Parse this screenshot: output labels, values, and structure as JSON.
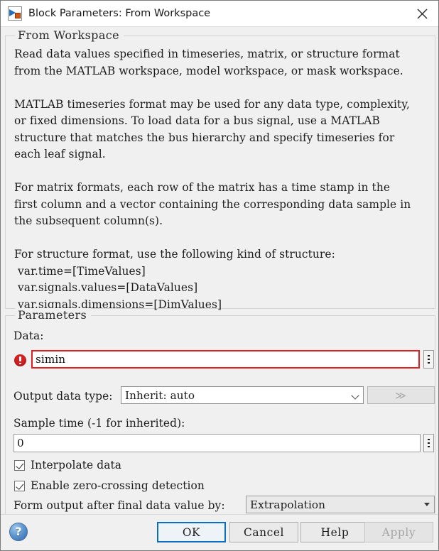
{
  "window": {
    "title": "Block Parameters: From Workspace",
    "icon": "simulink-block-icon",
    "close_label": "close-icon"
  },
  "description_group": {
    "legend": "From Workspace",
    "text": "Read data values specified in timeseries, matrix, or structure format\nfrom the MATLAB workspace, model workspace, or mask workspace.\n\nMATLAB timeseries format may be used for any data type, complexity,\nor fixed dimensions. To load data for a bus signal, use a MATLAB\nstructure that matches the bus hierarchy and specify timeseries for\neach leaf signal.\n\nFor matrix formats, each row of the matrix has a time stamp in the\nfirst column and a vector containing the corresponding data sample in\nthe subsequent column(s).\n\nFor structure format, use the following kind of structure:\n var.time=[TimeValues]\n var.signals.values=[DataValues]\n var.signals.dimensions=[DimValues]"
  },
  "parameters_group": {
    "legend": "Parameters",
    "data": {
      "label": "Data:",
      "value": "simin",
      "has_error": true,
      "error_icon": "error-icon",
      "more_button": "vertical-ellipsis-icon"
    },
    "output_data_type": {
      "label": "Output data type:",
      "value": "Inherit: auto",
      "expand_button_label": "≫",
      "expand_button_disabled": true
    },
    "sample_time": {
      "label": "Sample time (-1 for inherited):",
      "value": "0",
      "more_button": "vertical-ellipsis-icon"
    },
    "interpolate_data": {
      "label": "Interpolate data",
      "checked": true
    },
    "zero_crossing": {
      "label": "Enable zero-crossing detection",
      "checked": true
    },
    "form_output": {
      "label": "Form output after final data value by:",
      "value": "Extrapolation"
    }
  },
  "footer": {
    "help_icon": "help-icon",
    "help_glyph": "?",
    "buttons": {
      "ok": "OK",
      "cancel": "Cancel",
      "help": "Help",
      "apply": "Apply"
    },
    "apply_disabled": true,
    "ok_focused": true
  },
  "colors": {
    "background": "#f0f0f0",
    "error_red": "#e02020",
    "focus_blue": "#0a6fc2",
    "disabled_text": "#a5a5a5"
  }
}
